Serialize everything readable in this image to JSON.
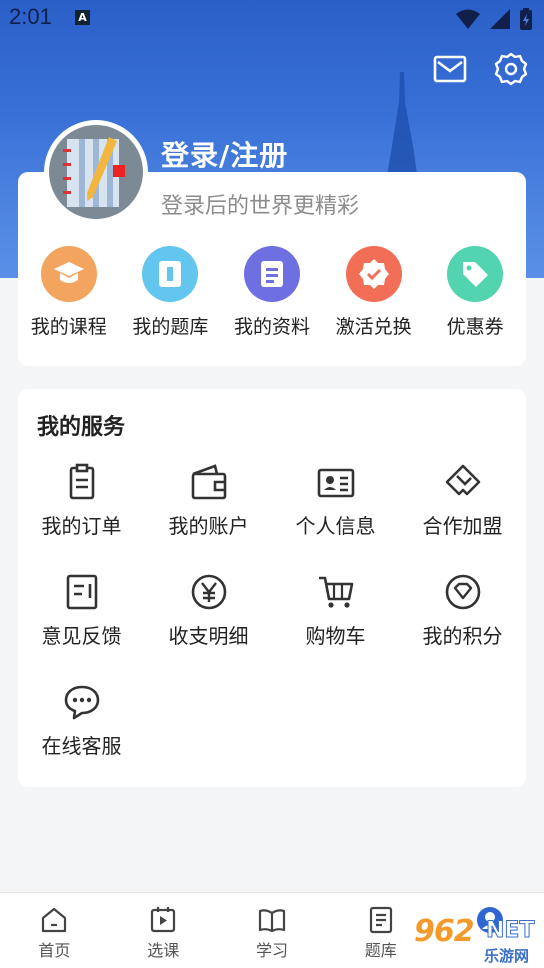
{
  "status_bar": {
    "time": "2:01",
    "notification_badge": "A"
  },
  "header": {
    "login_title": "登录/注册",
    "login_subtitle": "登录后的世界更精彩"
  },
  "quick_actions": [
    {
      "label": "我的课程",
      "icon": "graduation-cap-icon",
      "color": "#f3a45f"
    },
    {
      "label": "我的题库",
      "icon": "question-bank-icon",
      "color": "#63c6ee"
    },
    {
      "label": "我的资料",
      "icon": "document-icon",
      "color": "#6e6fe0"
    },
    {
      "label": "激活兑换",
      "icon": "badge-check-icon",
      "color": "#f26e56"
    },
    {
      "label": "优惠券",
      "icon": "tag-icon",
      "color": "#52d4b0"
    }
  ],
  "services": {
    "title": "我的服务",
    "items": [
      {
        "label": "我的订单",
        "icon": "clipboard-icon"
      },
      {
        "label": "我的账户",
        "icon": "wallet-icon"
      },
      {
        "label": "个人信息",
        "icon": "id-card-icon"
      },
      {
        "label": "合作加盟",
        "icon": "handshake-icon"
      },
      {
        "label": "意见反馈",
        "icon": "feedback-icon"
      },
      {
        "label": "收支明细",
        "icon": "yen-icon"
      },
      {
        "label": "购物车",
        "icon": "cart-icon"
      },
      {
        "label": "我的积分",
        "icon": "points-icon"
      },
      {
        "label": "在线客服",
        "icon": "chat-icon"
      }
    ]
  },
  "tabbar": [
    {
      "label": "首页",
      "icon": "home-icon"
    },
    {
      "label": "选课",
      "icon": "course-select-icon"
    },
    {
      "label": "学习",
      "icon": "book-icon"
    },
    {
      "label": "题库",
      "icon": "question-bank-tab-icon"
    },
    {
      "label": "",
      "icon": "profile-icon"
    }
  ],
  "watermark": {
    "number": "962",
    "net": "NET",
    "site": "乐游网"
  },
  "colors": {
    "primary": "#2f66cf",
    "icon_stroke": "#333333"
  }
}
